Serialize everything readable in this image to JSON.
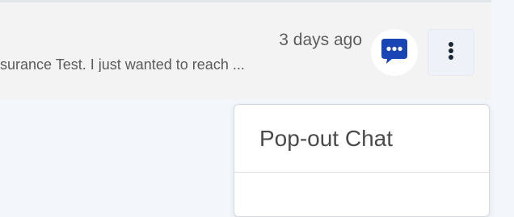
{
  "conversation": {
    "timestamp": "3 days ago",
    "preview": "surance Test. I just wanted to reach ..."
  },
  "icons": {
    "chat": "chat-bubble-icon",
    "more": "vertical-ellipsis-icon"
  },
  "colors": {
    "accent": "#1a46b5"
  },
  "menu": {
    "items": [
      {
        "label": "Pop-out Chat"
      }
    ]
  }
}
